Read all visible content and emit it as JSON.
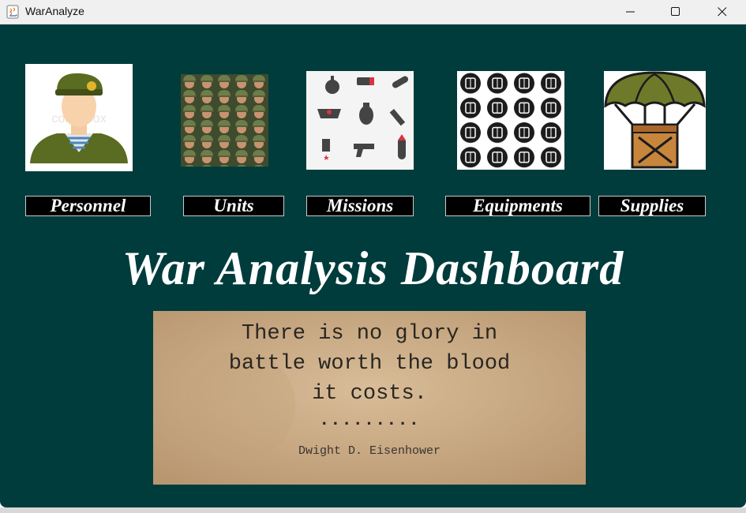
{
  "window": {
    "title": "WarAnalyze",
    "controls": [
      "minimize",
      "maximize",
      "close"
    ]
  },
  "tiles": [
    {
      "name": "personnel",
      "icon": "soldier-avatar-icon",
      "watermark": "colourbox"
    },
    {
      "name": "units",
      "icon": "soldiers-crowd-icon"
    },
    {
      "name": "missions",
      "icon": "weapons-pattern-icon"
    },
    {
      "name": "equipments",
      "icon": "gear-grid-icon"
    },
    {
      "name": "supplies",
      "icon": "parachute-crate-icon"
    }
  ],
  "nav": {
    "personnel": "Personnel",
    "units": "Units",
    "missions": "Missions",
    "equipments": "Equipments",
    "supplies": "Supplies"
  },
  "dashboard_title": "War Analysis Dashboard",
  "quote": {
    "line1": "There is no glory in",
    "line2": "battle worth the blood",
    "line3": "it costs.",
    "separator": ".........",
    "author": "Dwight D. Eisenhower"
  },
  "colors": {
    "background": "#003c3c",
    "button_bg": "#000000",
    "text": "#ffffff",
    "quote_paper": "#cdb08a"
  }
}
